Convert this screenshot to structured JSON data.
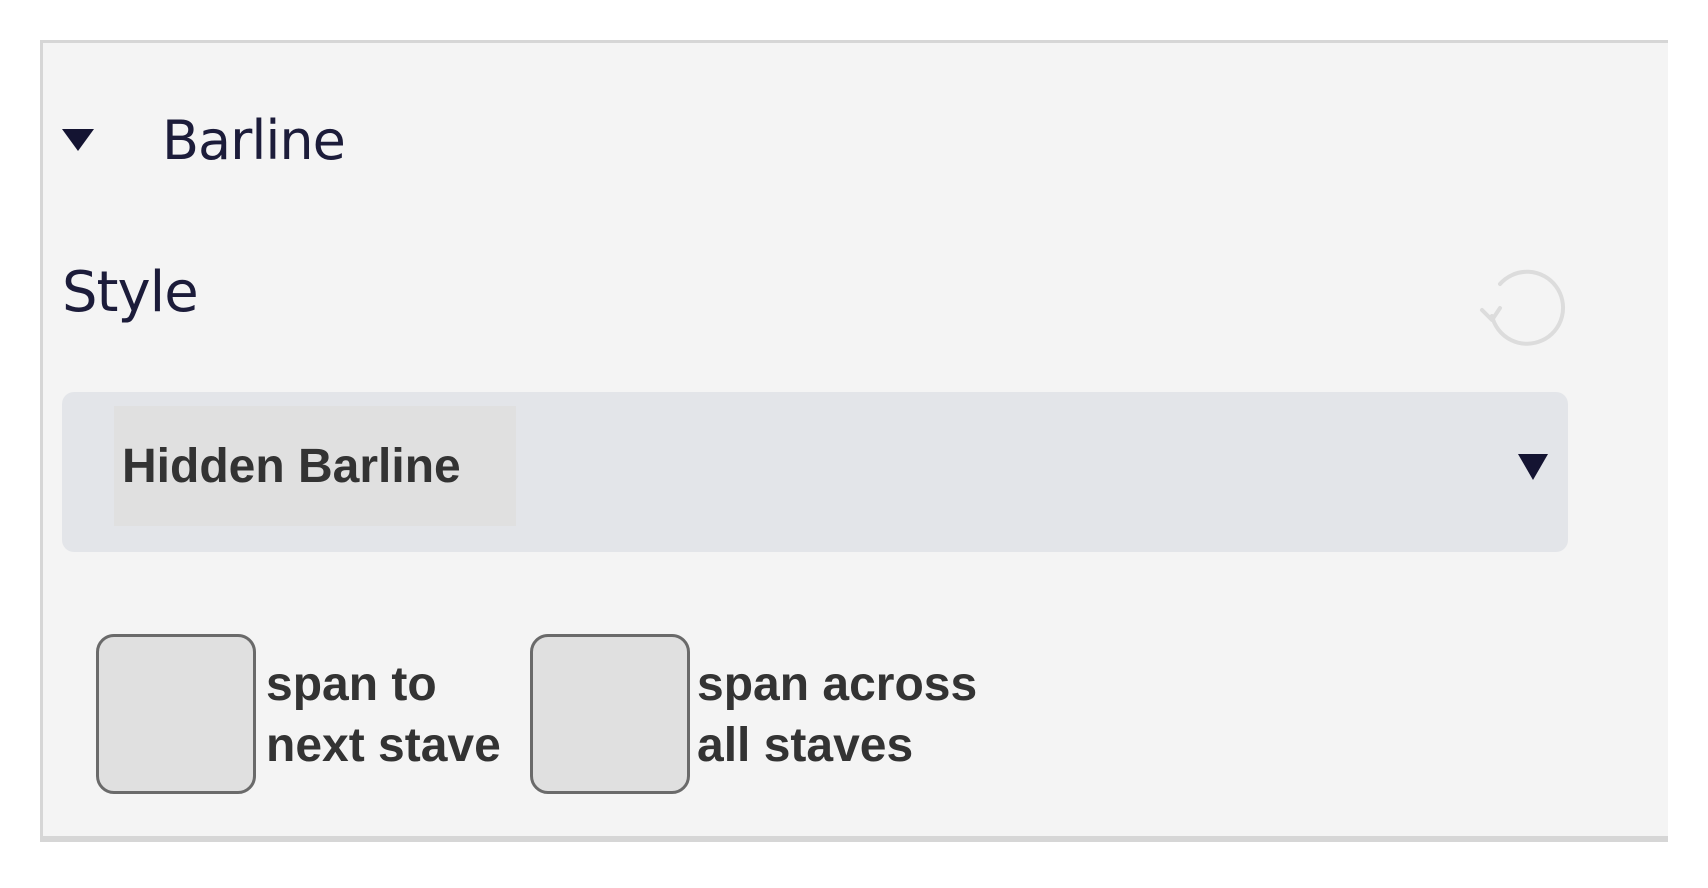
{
  "section": {
    "title": "Barline",
    "expanded": true
  },
  "style_field": {
    "label": "Style",
    "reset_icon": "reset-icon",
    "selected_value": "Hidden Barline"
  },
  "checkboxes": [
    {
      "line1": "span to",
      "line2": "next stave",
      "checked": false
    },
    {
      "line1": "span across",
      "line2": "all staves",
      "checked": false
    }
  ],
  "colors": {
    "panel_bg": "#f4f4f4",
    "dropdown_bg": "#e3e5e9",
    "text_dark": "#1c1c3a",
    "text_body": "#333333"
  }
}
